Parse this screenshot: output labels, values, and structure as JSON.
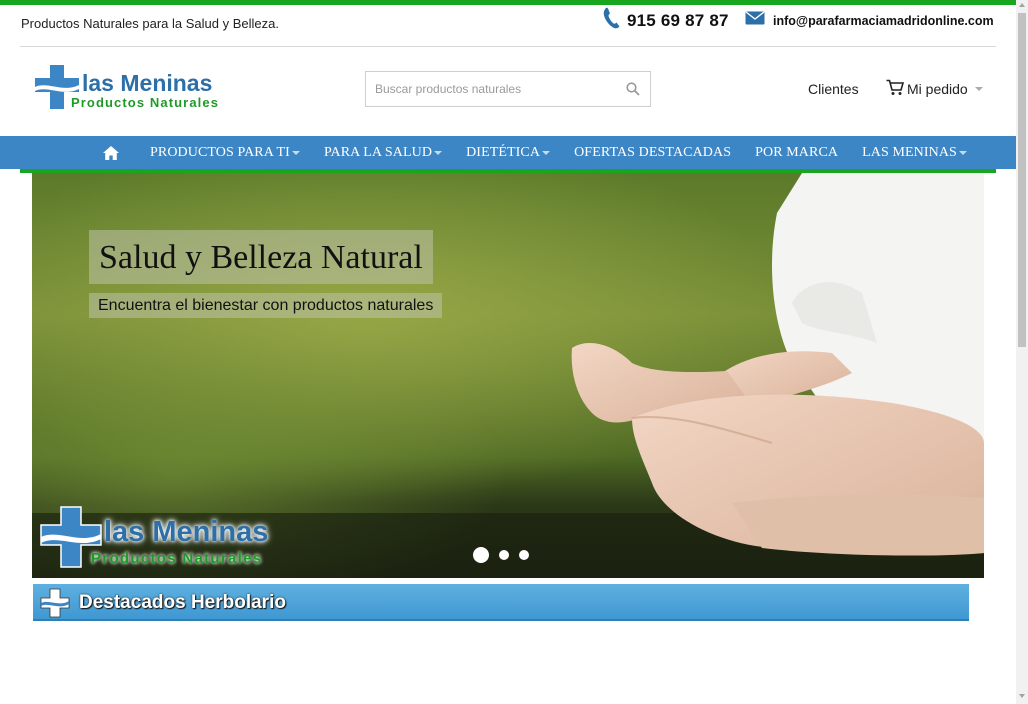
{
  "topbar": {
    "tagline": "Productos Naturales para la Salud y Belleza.",
    "phone": "915 69 87 87",
    "email": "info@parafarmaciamadridonline.com"
  },
  "header": {
    "logo_title": "las Meninas",
    "logo_subtitle": "Productos Naturales",
    "search_placeholder": "Buscar productos naturales",
    "clientes_label": "Clientes",
    "cart_label": "Mi pedido"
  },
  "nav": {
    "items": [
      {
        "label": "PRODUCTOS PARA TI",
        "has_dropdown": true
      },
      {
        "label": "PARA LA SALUD",
        "has_dropdown": true
      },
      {
        "label": "DIETÉTICA",
        "has_dropdown": true
      },
      {
        "label": "OFERTAS DESTACADAS",
        "has_dropdown": false
      },
      {
        "label": "POR MARCA",
        "has_dropdown": false
      },
      {
        "label": "LAS MENINAS",
        "has_dropdown": true
      }
    ]
  },
  "slider": {
    "title": "Salud y Belleza Natural",
    "subtitle": "Encuentra el bienestar con productos naturales",
    "logo_title": "las Meninas",
    "logo_subtitle": "Productos Naturales",
    "slide_count": 3,
    "active_slide": 1
  },
  "section": {
    "title": "Destacados Herbolario"
  },
  "colors": {
    "accent_green": "#19a61f",
    "nav_blue": "#3d86c6",
    "brand_blue": "#2d6fa8",
    "brand_green": "#1e9b27",
    "banner_blue": "#4aa3d8"
  },
  "icons": {
    "phone": "phone-icon",
    "email": "envelope-icon",
    "search": "search-icon",
    "cart": "cart-icon",
    "home": "home-icon",
    "logo": "cross-logo-icon"
  }
}
